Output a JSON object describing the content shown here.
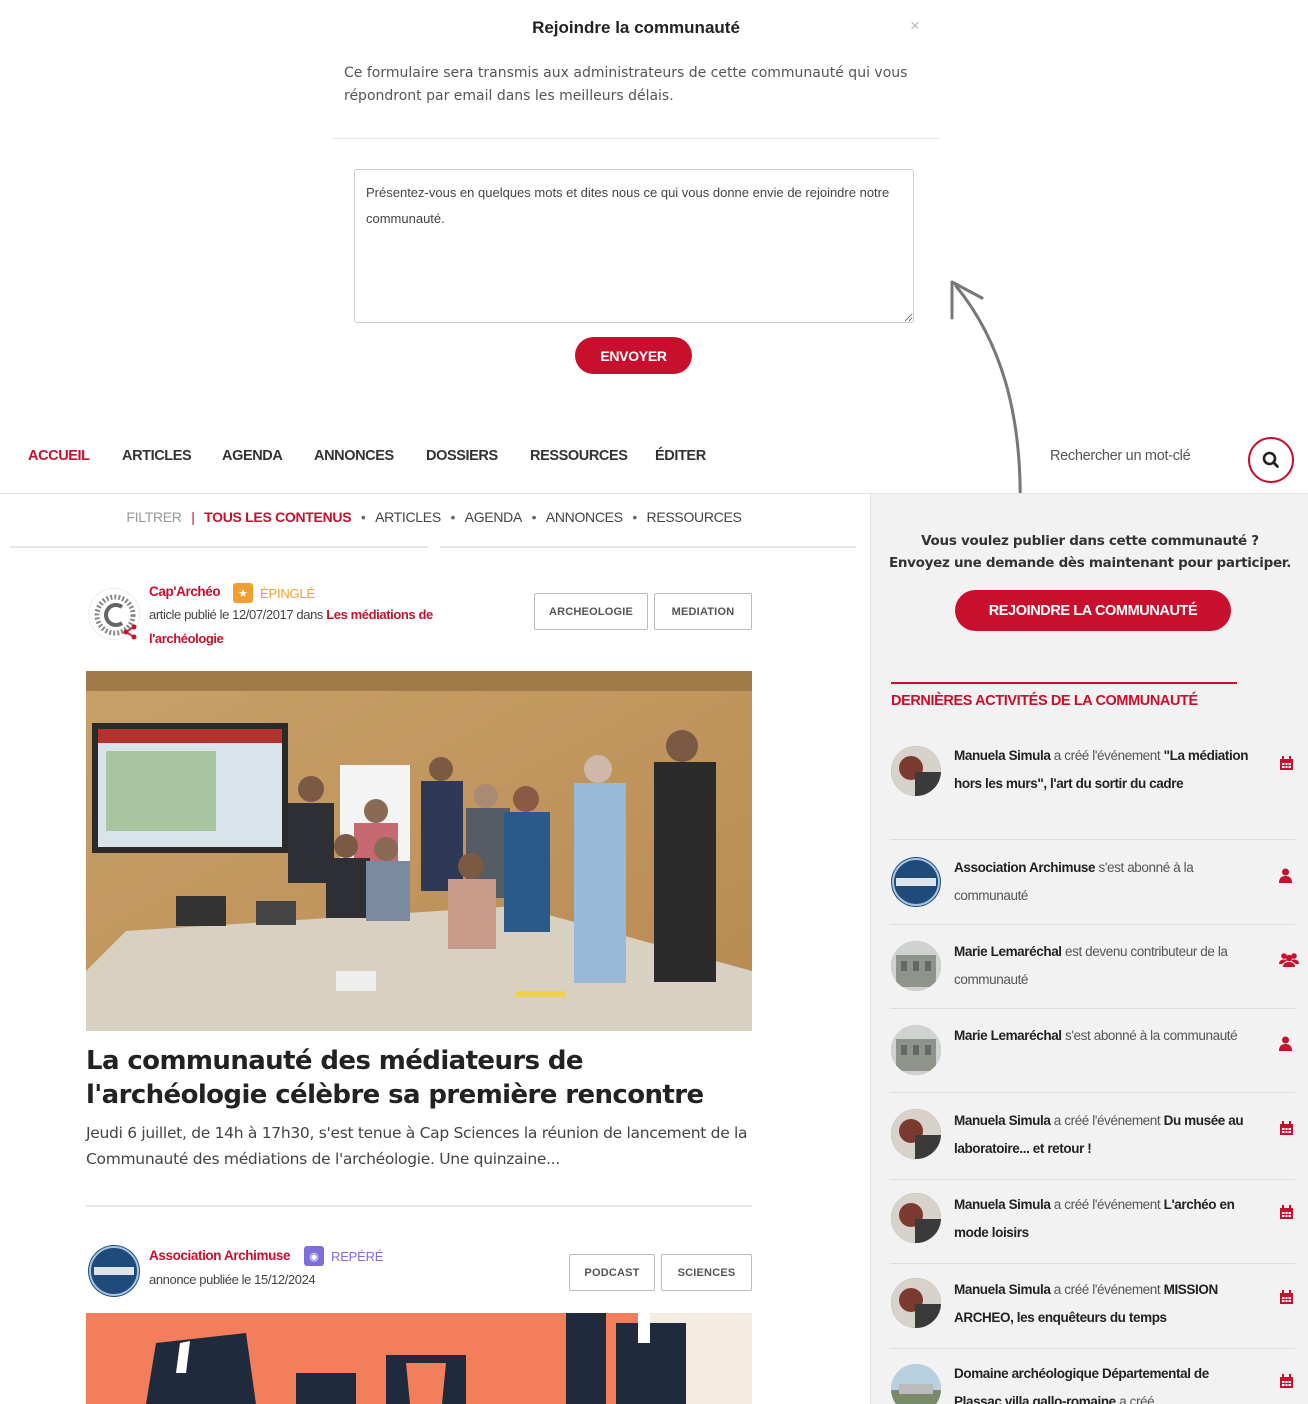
{
  "modal": {
    "title": "Rejoindre la communauté",
    "close": "×",
    "intro": "Ce formulaire sera transmis aux administrateurs de cette communauté qui vous répondront par email dans les meilleurs délais.",
    "placeholder": "Présentez-vous en quelques mots et dites nous ce qui vous donne envie de rejoindre notre communauté.",
    "send_label": "ENVOYER"
  },
  "nav": {
    "items": [
      "ACCUEIL",
      "ARTICLES",
      "AGENDA",
      "ANNONCES",
      "DOSSIERS",
      "RESSOURCES",
      "ÉDITER"
    ],
    "search_label": "Rechercher un mot-clé"
  },
  "filter": {
    "label": "FILTRER",
    "separator": "|",
    "active": "TOUS LES CONTENUS",
    "items": [
      "ARTICLES",
      "AGENDA",
      "ANNONCES",
      "RESSOURCES"
    ],
    "dot": "•"
  },
  "cards": [
    {
      "author": "Cap'Archéo",
      "badge": "ÉPINGLÉ",
      "meta_prefix": "article publié le 12/07/2017 dans ",
      "meta_link": "Les médiations de l'archéologie",
      "tags": [
        "ARCHEOLOGIE",
        "MEDIATION"
      ],
      "title": "La communauté des médiateurs de l'archéologie célèbre sa première rencontre",
      "excerpt": "Jeudi 6 juillet, de 14h à 17h30, s'est tenue à Cap Sciences la réunion de lancement de la Communauté des médiations de l'archéologie. Une quinzaine..."
    },
    {
      "author": "Association Archimuse",
      "badge": "REPÉRÉ",
      "meta_prefix": "annonce publiée le 15/12/2024",
      "tags": [
        "PODCAST",
        "SCIENCES"
      ]
    }
  ],
  "sidebar": {
    "prompt_line1": "Vous voulez publier dans cette communauté ?",
    "prompt_line2": "Envoyez une demande dès maintenant pour participer.",
    "join_label": "REJOINDRE LA COMMUNAUTÉ",
    "heading": "DERNIÈRES ACTIVITÉS DE LA COMMUNAUTÉ",
    "activities": [
      {
        "actor": "Manuela Simula",
        "verb": " a créé l'événement ",
        "object": "\"La médiation hors les murs\", l'art du sortir du cadre",
        "icon": "calendar-icon"
      },
      {
        "actor": "Association Archimuse",
        "verb": " s'est abonné à la communauté",
        "object": "",
        "icon": "user-icon"
      },
      {
        "actor": "Marie Lemaréchal",
        "verb": " est devenu contributeur de la communauté",
        "object": "",
        "icon": "users-icon"
      },
      {
        "actor": "Marie Lemaréchal",
        "verb": " s'est abonné à la communauté",
        "object": "",
        "icon": "user-icon"
      },
      {
        "actor": "Manuela Simula",
        "verb": " a créé l'événement ",
        "object": "Du musée au laboratoire... et retour !",
        "icon": "calendar-icon"
      },
      {
        "actor": "Manuela Simula",
        "verb": " a créé l'événement ",
        "object": "L'archéo en mode loisirs",
        "icon": "calendar-icon"
      },
      {
        "actor": "Manuela Simula",
        "verb": " a créé l'événement ",
        "object": "MISSION ARCHEO, les enquêteurs du temps",
        "icon": "calendar-icon"
      },
      {
        "actor": "Domaine archéologique Départemental de Plassac villa gallo-romaine",
        "verb": " a créé",
        "object": "",
        "icon": "calendar-icon"
      }
    ]
  },
  "colors": {
    "accent": "#c8102e",
    "pinned": "#f0a030",
    "spotted": "#7c6fd8"
  }
}
